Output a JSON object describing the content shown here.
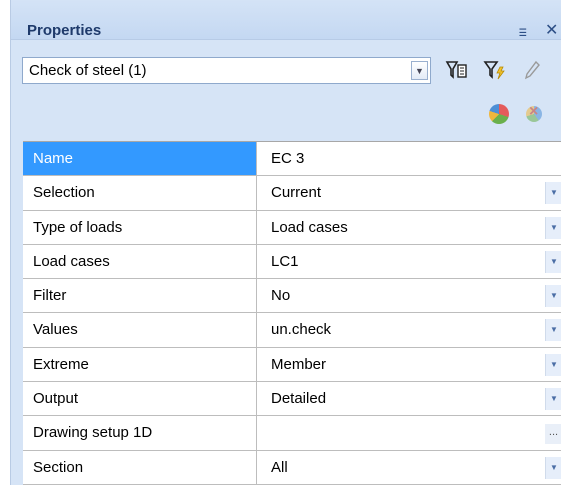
{
  "panel": {
    "title": "Properties",
    "pin_glyph": "ⲷ",
    "close_glyph": "✕"
  },
  "toolbar": {
    "selector_value": "Check of steel (1)",
    "icons": [
      "filter-edit-icon",
      "filter-lightning-icon",
      "pencil-icon",
      "pie-chart-icon",
      "pie-chart-delete-icon"
    ]
  },
  "grid": {
    "rows": [
      {
        "name": "Name",
        "value": "EC 3",
        "editor": "text"
      },
      {
        "name": "Selection",
        "value": "Current",
        "editor": "dropdown"
      },
      {
        "name": "Type of loads",
        "value": "Load cases",
        "editor": "dropdown"
      },
      {
        "name": "Load cases",
        "value": "LC1",
        "editor": "dropdown"
      },
      {
        "name": "Filter",
        "value": "No",
        "editor": "dropdown"
      },
      {
        "name": "Values",
        "value": "un.check",
        "editor": "dropdown"
      },
      {
        "name": "Extreme",
        "value": "Member",
        "editor": "dropdown"
      },
      {
        "name": "Output",
        "value": "Detailed",
        "editor": "dropdown"
      },
      {
        "name": "Drawing setup 1D",
        "value": "",
        "editor": "ellipsis"
      },
      {
        "name": "Section",
        "value": "All",
        "editor": "dropdown"
      }
    ],
    "ellipsis_label": "..."
  },
  "colors": {
    "selection": "#3399ff",
    "panel_background": "#d6e4f6",
    "title_text": "#1e3a6b"
  }
}
